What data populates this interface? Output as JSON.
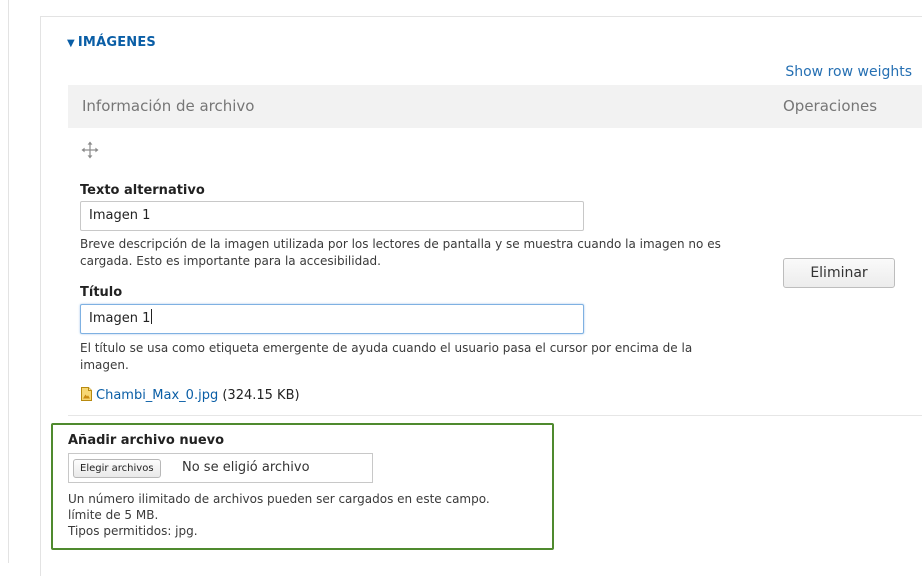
{
  "section": {
    "title": "IMÁGENES",
    "toggle_glyph": "▼"
  },
  "show_row_weights": "Show row weights",
  "table": {
    "headers": [
      "Información de archivo",
      "Operaciones"
    ]
  },
  "row": {
    "drag_icon": "move-arrows-icon",
    "alt": {
      "label": "Texto alternativo",
      "value": "Imagen 1",
      "description": "Breve descripción de la imagen utilizada por los lectores de pantalla y se muestra cuando la imagen no es cargada. Esto es importante para la accesibilidad."
    },
    "title": {
      "label": "Título",
      "value": "Imagen 1",
      "description": "El título se usa como etiqueta emergente de ayuda cuando el usuario pasa el cursor por encima de la imagen."
    },
    "file": {
      "icon": "image-file-icon",
      "name": "Chambi_Max_0.jpg",
      "size": "(324.15 KB)"
    },
    "delete_label": "Eliminar"
  },
  "new_file": {
    "label": "Añadir archivo nuevo",
    "choose_button": "Elegir archivos",
    "no_file_text": "No se eligió archivo",
    "help_lines": [
      "Un número ilimitado de archivos pueden ser cargados en este campo.",
      "límite de 5 MB.",
      "Tipos permitidos: jpg."
    ]
  },
  "colors": {
    "link": "#0a5ea6",
    "highlight_border": "#4f8a2e",
    "header_bg": "#f2f2f2"
  }
}
